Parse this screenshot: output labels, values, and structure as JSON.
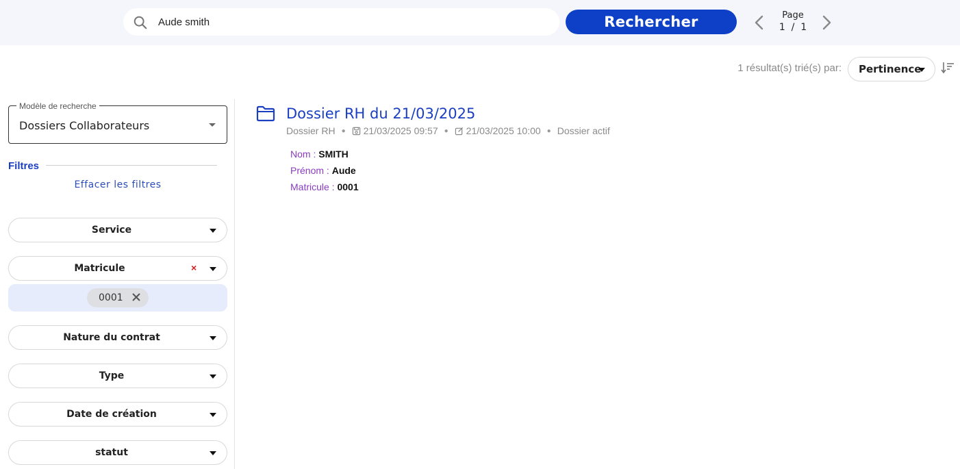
{
  "search": {
    "query": "Aude smith",
    "button_label": "Rechercher"
  },
  "pager": {
    "label": "Page",
    "value": "1  /  1"
  },
  "results_header": {
    "count_text": "1 résultat(s) trié(s) par:",
    "sort_value": "Pertinence"
  },
  "sidebar": {
    "model_legend": "Modèle de recherche",
    "model_value": "Dossiers Collaborateurs",
    "filters_title": "Filtres",
    "clear_filters": "Effacer les filtres",
    "filters": [
      {
        "label": "Service"
      },
      {
        "label": "Matricule",
        "clear_symbol": "×",
        "chips": [
          "0001"
        ]
      },
      {
        "label": "Nature du contrat"
      },
      {
        "label": "Type"
      },
      {
        "label": "Date de création"
      },
      {
        "label": "statut"
      }
    ]
  },
  "result": {
    "title": "Dossier RH du 21/03/2025",
    "meta": {
      "type": "Dossier RH",
      "created": "21/03/2025 09:57",
      "modified": "21/03/2025 10:00",
      "status": "Dossier actif"
    },
    "fields": [
      {
        "label": "Nom :",
        "value": "SMITH"
      },
      {
        "label": "Prénom :",
        "value": "Aude"
      },
      {
        "label": "Matricule :",
        "value": "0001"
      }
    ]
  },
  "colors": {
    "accent": "#0d3fc7",
    "title_blue": "#1a3fc0",
    "field_label_purple": "#8a3cc0",
    "clear_red": "#d02020"
  }
}
